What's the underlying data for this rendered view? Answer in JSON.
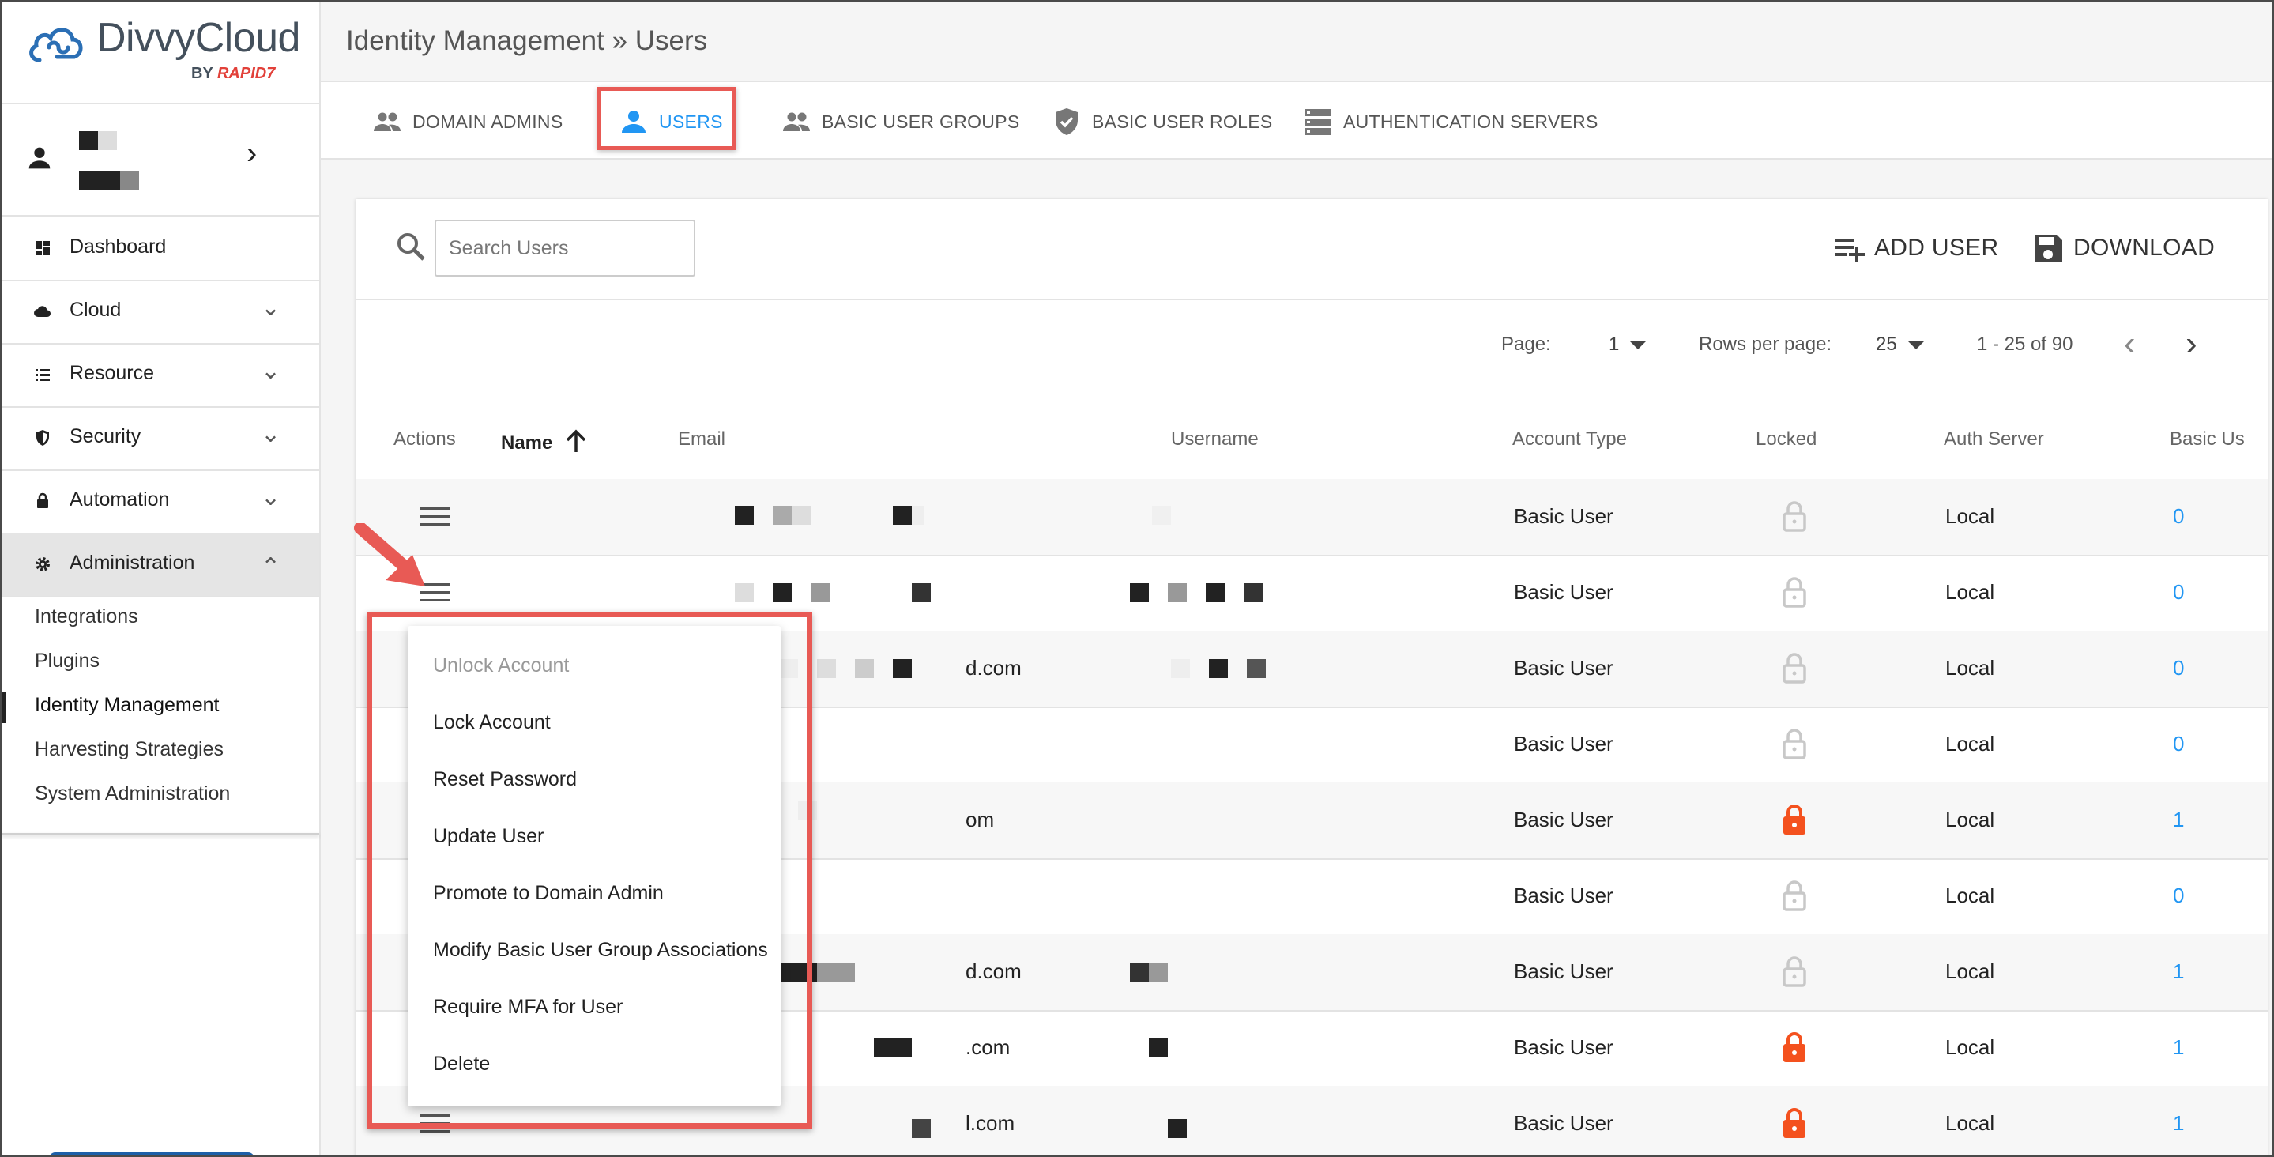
{
  "logo": {
    "name": "DivvyCloud",
    "by": "BY",
    "brand": "RAPID7"
  },
  "breadcrumb": "Identity Management » Users",
  "sidebar": {
    "items": [
      {
        "label": "Dashboard",
        "icon": "dashboard-icon"
      },
      {
        "label": "Cloud",
        "icon": "cloud-icon"
      },
      {
        "label": "Resource",
        "icon": "list-icon"
      },
      {
        "label": "Security",
        "icon": "shield-icon"
      },
      {
        "label": "Automation",
        "icon": "lock-icon"
      },
      {
        "label": "Administration",
        "icon": "gear-icon"
      }
    ],
    "sub_items": [
      "Integrations",
      "Plugins",
      "Identity Management",
      "Harvesting Strategies",
      "System Administration"
    ]
  },
  "tabs": [
    {
      "label": "DOMAIN ADMINS",
      "icon": "people-icon"
    },
    {
      "label": "USERS",
      "icon": "person-icon"
    },
    {
      "label": "BASIC USER GROUPS",
      "icon": "people-icon"
    },
    {
      "label": "BASIC USER ROLES",
      "icon": "shield-check-icon"
    },
    {
      "label": "AUTHENTICATION SERVERS",
      "icon": "server-icon"
    }
  ],
  "toolbar": {
    "search_placeholder": "Search Users",
    "add_user": "ADD USER",
    "download": "DOWNLOAD"
  },
  "pager": {
    "page_label": "Page:",
    "page_value": "1",
    "rows_label": "Rows per page:",
    "rows_value": "25",
    "range": "1 - 25 of 90"
  },
  "columns": [
    "Actions",
    "Name",
    "Email",
    "Username",
    "Account Type",
    "Locked",
    "Auth Server",
    "Basic Us"
  ],
  "rows": [
    {
      "email_end": "",
      "account_type": "Basic User",
      "locked": false,
      "auth_server": "Local",
      "groups": "0"
    },
    {
      "email_end": "",
      "account_type": "Basic User",
      "locked": false,
      "auth_server": "Local",
      "groups": "0"
    },
    {
      "email_end": "d.com",
      "account_type": "Basic User",
      "locked": false,
      "auth_server": "Local",
      "groups": "0"
    },
    {
      "email_end": "",
      "account_type": "Basic User",
      "locked": false,
      "auth_server": "Local",
      "groups": "0"
    },
    {
      "email_end": "om",
      "account_type": "Basic User",
      "locked": true,
      "auth_server": "Local",
      "groups": "1"
    },
    {
      "email_end": "",
      "account_type": "Basic User",
      "locked": false,
      "auth_server": "Local",
      "groups": "0"
    },
    {
      "email_end": "d.com",
      "account_type": "Basic User",
      "locked": false,
      "auth_server": "Local",
      "groups": "1"
    },
    {
      "email_end": ".com",
      "account_type": "Basic User",
      "locked": true,
      "auth_server": "Local",
      "groups": "1"
    },
    {
      "email_end": "l.com",
      "account_type": "Basic User",
      "locked": true,
      "auth_server": "Local",
      "groups": "1"
    }
  ],
  "context_menu": [
    {
      "label": "Unlock Account",
      "disabled": true
    },
    {
      "label": "Lock Account",
      "disabled": false
    },
    {
      "label": "Reset Password",
      "disabled": false
    },
    {
      "label": "Update User",
      "disabled": false
    },
    {
      "label": "Promote to Domain Admin",
      "disabled": false
    },
    {
      "label": "Modify Basic User Group Associations",
      "disabled": false
    },
    {
      "label": "Require MFA for User",
      "disabled": false
    },
    {
      "label": "Delete",
      "disabled": false
    }
  ],
  "colors": {
    "accent": "#2196f3",
    "highlight": "#e85a55",
    "lock_red": "#f4511e",
    "lock_grey": "#c8c8c8"
  }
}
